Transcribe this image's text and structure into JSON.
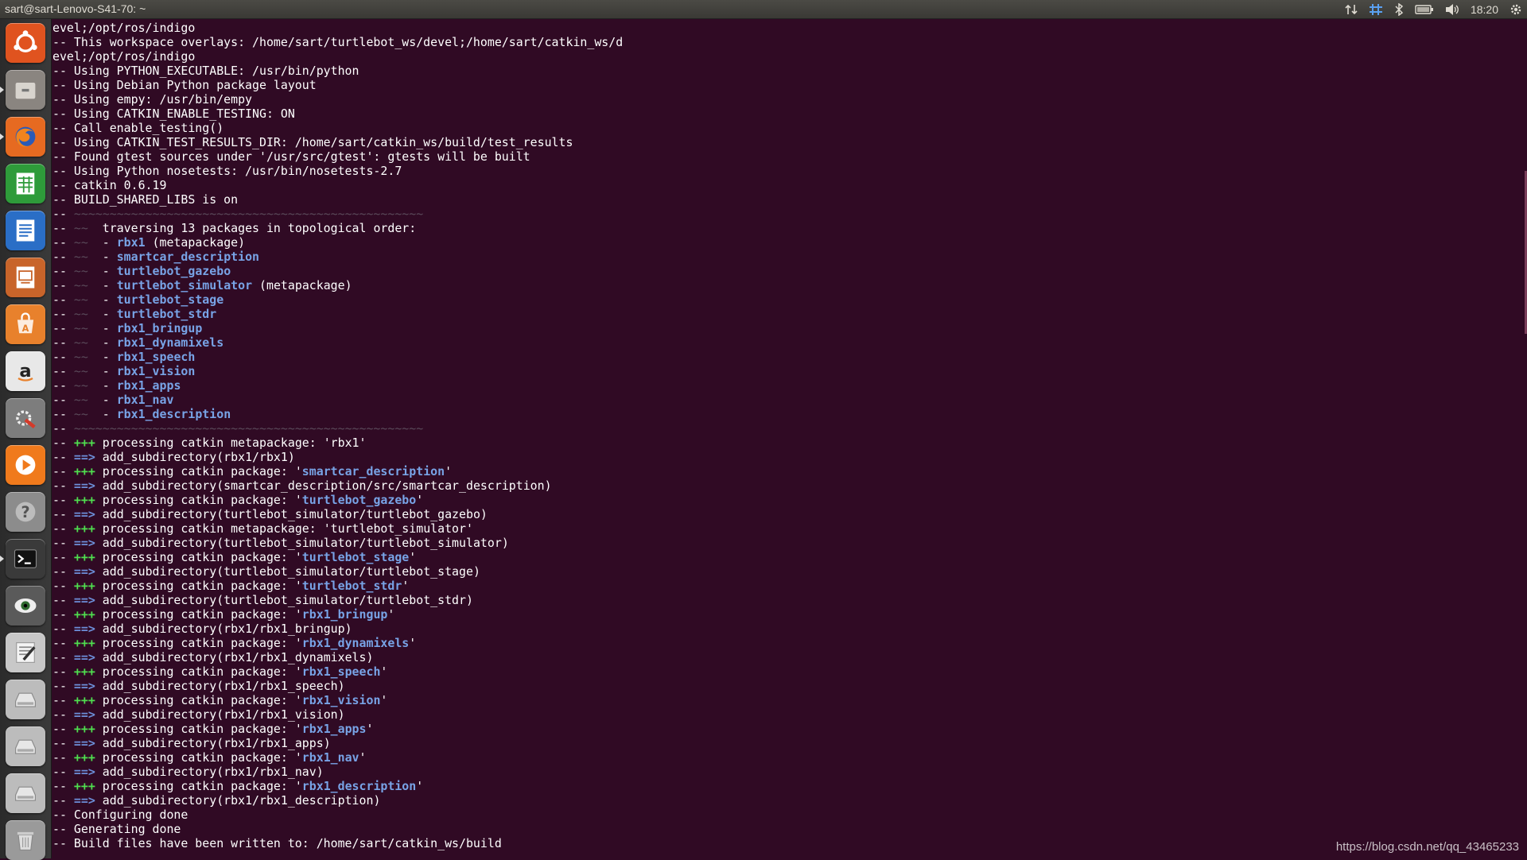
{
  "topbar": {
    "window_title": "sart@sart-Lenovo-S41-70: ~",
    "indicators": [
      {
        "icon": "network-transfer-icon"
      },
      {
        "icon": "input-method-icon"
      },
      {
        "icon": "bluetooth-icon"
      },
      {
        "icon": "battery-icon"
      },
      {
        "icon": "volume-icon"
      },
      {
        "icon": "clock",
        "text": "18:20"
      },
      {
        "icon": "gear-icon"
      }
    ]
  },
  "launcher": {
    "items": [
      {
        "name": "ubuntu-dash-icon",
        "color": "#e0531f"
      },
      {
        "name": "files-icon",
        "color": "#8a8580"
      },
      {
        "name": "firefox-icon",
        "color": "#e66a21"
      },
      {
        "name": "libreoffice-calc-icon",
        "color": "#2e9b3a"
      },
      {
        "name": "libreoffice-writer-icon",
        "color": "#2a6ec6"
      },
      {
        "name": "libreoffice-impress-icon",
        "color": "#c8642a"
      },
      {
        "name": "software-center-icon",
        "color": "#e8812c"
      },
      {
        "name": "amazon-icon",
        "color": "#e8e8e8"
      },
      {
        "name": "system-settings-icon",
        "color": "#7d7d7d"
      },
      {
        "name": "media-player-icon",
        "color": "#f07a1c"
      },
      {
        "name": "help-icon",
        "color": "#8c8c8c"
      },
      {
        "name": "terminal-icon",
        "color": "#3a3a3a"
      },
      {
        "name": "image-viewer-icon",
        "color": "#5a5a5a"
      },
      {
        "name": "text-editor-icon",
        "color": "#c8c8c8"
      },
      {
        "name": "drive-icon-1",
        "color": "#bcbcbc"
      },
      {
        "name": "drive-icon-2",
        "color": "#bcbcbc"
      },
      {
        "name": "drive-icon-3",
        "color": "#bcbcbc"
      },
      {
        "name": "trash-icon",
        "color": "#9a9a9a"
      }
    ]
  },
  "terminal": {
    "lines": [
      [
        {
          "t": "evel;/opt/ros/indigo"
        }
      ],
      [
        {
          "t": "-- This workspace overlays: /home/sart/turtlebot_ws/devel;/home/sart/catkin_ws/d"
        }
      ],
      [
        {
          "t": "evel;/opt/ros/indigo"
        }
      ],
      [
        {
          "t": "-- Using PYTHON_EXECUTABLE: /usr/bin/python"
        }
      ],
      [
        {
          "t": "-- Using Debian Python package layout"
        }
      ],
      [
        {
          "t": "-- Using empy: /usr/bin/empy"
        }
      ],
      [
        {
          "t": "-- Using CATKIN_ENABLE_TESTING: ON"
        }
      ],
      [
        {
          "t": "-- Call enable_testing()"
        }
      ],
      [
        {
          "t": "-- Using CATKIN_TEST_RESULTS_DIR: /home/sart/catkin_ws/build/test_results"
        }
      ],
      [
        {
          "t": "-- Found gtest sources under '/usr/src/gtest': gtests will be built"
        }
      ],
      [
        {
          "t": "-- Using Python nosetests: /usr/bin/nosetests-2.7"
        }
      ],
      [
        {
          "t": "-- catkin 0.6.19"
        }
      ],
      [
        {
          "t": "-- BUILD_SHARED_LIBS is on"
        }
      ],
      [
        {
          "t": "-- "
        },
        {
          "t": "~~~~~~~~~~~~~~~~~~~~~~~~~~~~~~~~~~~~~~~~~~~~~~~~~",
          "c": "dim"
        }
      ],
      [
        {
          "t": "-- "
        },
        {
          "t": "~~",
          "c": "dim"
        },
        {
          "t": "  traversing 13 packages in topological order:"
        }
      ],
      [
        {
          "t": "-- "
        },
        {
          "t": "~~",
          "c": "dim"
        },
        {
          "t": "  - "
        },
        {
          "t": "rbx1",
          "c": "pkg"
        },
        {
          "t": " (metapackage)"
        }
      ],
      [
        {
          "t": "-- "
        },
        {
          "t": "~~",
          "c": "dim"
        },
        {
          "t": "  - "
        },
        {
          "t": "smartcar_description",
          "c": "pkg"
        }
      ],
      [
        {
          "t": "-- "
        },
        {
          "t": "~~",
          "c": "dim"
        },
        {
          "t": "  - "
        },
        {
          "t": "turtlebot_gazebo",
          "c": "pkg"
        }
      ],
      [
        {
          "t": "-- "
        },
        {
          "t": "~~",
          "c": "dim"
        },
        {
          "t": "  - "
        },
        {
          "t": "turtlebot_simulator",
          "c": "pkg"
        },
        {
          "t": " (metapackage)"
        }
      ],
      [
        {
          "t": "-- "
        },
        {
          "t": "~~",
          "c": "dim"
        },
        {
          "t": "  - "
        },
        {
          "t": "turtlebot_stage",
          "c": "pkg"
        }
      ],
      [
        {
          "t": "-- "
        },
        {
          "t": "~~",
          "c": "dim"
        },
        {
          "t": "  - "
        },
        {
          "t": "turtlebot_stdr",
          "c": "pkg"
        }
      ],
      [
        {
          "t": "-- "
        },
        {
          "t": "~~",
          "c": "dim"
        },
        {
          "t": "  - "
        },
        {
          "t": "rbx1_bringup",
          "c": "pkg"
        }
      ],
      [
        {
          "t": "-- "
        },
        {
          "t": "~~",
          "c": "dim"
        },
        {
          "t": "  - "
        },
        {
          "t": "rbx1_dynamixels",
          "c": "pkg"
        }
      ],
      [
        {
          "t": "-- "
        },
        {
          "t": "~~",
          "c": "dim"
        },
        {
          "t": "  - "
        },
        {
          "t": "rbx1_speech",
          "c": "pkg"
        }
      ],
      [
        {
          "t": "-- "
        },
        {
          "t": "~~",
          "c": "dim"
        },
        {
          "t": "  - "
        },
        {
          "t": "rbx1_vision",
          "c": "pkg"
        }
      ],
      [
        {
          "t": "-- "
        },
        {
          "t": "~~",
          "c": "dim"
        },
        {
          "t": "  - "
        },
        {
          "t": "rbx1_apps",
          "c": "pkg"
        }
      ],
      [
        {
          "t": "-- "
        },
        {
          "t": "~~",
          "c": "dim"
        },
        {
          "t": "  - "
        },
        {
          "t": "rbx1_nav",
          "c": "pkg"
        }
      ],
      [
        {
          "t": "-- "
        },
        {
          "t": "~~",
          "c": "dim"
        },
        {
          "t": "  - "
        },
        {
          "t": "rbx1_description",
          "c": "pkg"
        }
      ],
      [
        {
          "t": "-- "
        },
        {
          "t": "~~~~~~~~~~~~~~~~~~~~~~~~~~~~~~~~~~~~~~~~~~~~~~~~~",
          "c": "dim"
        }
      ],
      [
        {
          "t": "-- "
        },
        {
          "t": "+++",
          "c": "plus"
        },
        {
          "t": " processing catkin metapackage: 'rbx1'"
        }
      ],
      [
        {
          "t": "-- "
        },
        {
          "t": "==>",
          "c": "arrow"
        },
        {
          "t": " add_subdirectory(rbx1/rbx1)"
        }
      ],
      [
        {
          "t": "-- "
        },
        {
          "t": "+++",
          "c": "plus"
        },
        {
          "t": " processing catkin package: '"
        },
        {
          "t": "smartcar_description",
          "c": "pkg"
        },
        {
          "t": "'"
        }
      ],
      [
        {
          "t": "-- "
        },
        {
          "t": "==>",
          "c": "arrow"
        },
        {
          "t": " add_subdirectory(smartcar_description/src/smartcar_description)"
        }
      ],
      [
        {
          "t": "-- "
        },
        {
          "t": "+++",
          "c": "plus"
        },
        {
          "t": " processing catkin package: '"
        },
        {
          "t": "turtlebot_gazebo",
          "c": "pkg"
        },
        {
          "t": "'"
        }
      ],
      [
        {
          "t": "-- "
        },
        {
          "t": "==>",
          "c": "arrow"
        },
        {
          "t": " add_subdirectory(turtlebot_simulator/turtlebot_gazebo)"
        }
      ],
      [
        {
          "t": "-- "
        },
        {
          "t": "+++",
          "c": "plus"
        },
        {
          "t": " processing catkin metapackage: 'turtlebot_simulator'"
        }
      ],
      [
        {
          "t": "-- "
        },
        {
          "t": "==>",
          "c": "arrow"
        },
        {
          "t": " add_subdirectory(turtlebot_simulator/turtlebot_simulator)"
        }
      ],
      [
        {
          "t": "-- "
        },
        {
          "t": "+++",
          "c": "plus"
        },
        {
          "t": " processing catkin package: '"
        },
        {
          "t": "turtlebot_stage",
          "c": "pkg"
        },
        {
          "t": "'"
        }
      ],
      [
        {
          "t": "-- "
        },
        {
          "t": "==>",
          "c": "arrow"
        },
        {
          "t": " add_subdirectory(turtlebot_simulator/turtlebot_stage)"
        }
      ],
      [
        {
          "t": "-- "
        },
        {
          "t": "+++",
          "c": "plus"
        },
        {
          "t": " processing catkin package: '"
        },
        {
          "t": "turtlebot_stdr",
          "c": "pkg"
        },
        {
          "t": "'"
        }
      ],
      [
        {
          "t": "-- "
        },
        {
          "t": "==>",
          "c": "arrow"
        },
        {
          "t": " add_subdirectory(turtlebot_simulator/turtlebot_stdr)"
        }
      ],
      [
        {
          "t": "-- "
        },
        {
          "t": "+++",
          "c": "plus"
        },
        {
          "t": " processing catkin package: '"
        },
        {
          "t": "rbx1_bringup",
          "c": "pkg"
        },
        {
          "t": "'"
        }
      ],
      [
        {
          "t": "-- "
        },
        {
          "t": "==>",
          "c": "arrow"
        },
        {
          "t": " add_subdirectory(rbx1/rbx1_bringup)"
        }
      ],
      [
        {
          "t": "-- "
        },
        {
          "t": "+++",
          "c": "plus"
        },
        {
          "t": " processing catkin package: '"
        },
        {
          "t": "rbx1_dynamixels",
          "c": "pkg"
        },
        {
          "t": "'"
        }
      ],
      [
        {
          "t": "-- "
        },
        {
          "t": "==>",
          "c": "arrow"
        },
        {
          "t": " add_subdirectory(rbx1/rbx1_dynamixels)"
        }
      ],
      [
        {
          "t": "-- "
        },
        {
          "t": "+++",
          "c": "plus"
        },
        {
          "t": " processing catkin package: '"
        },
        {
          "t": "rbx1_speech",
          "c": "pkg"
        },
        {
          "t": "'"
        }
      ],
      [
        {
          "t": "-- "
        },
        {
          "t": "==>",
          "c": "arrow"
        },
        {
          "t": " add_subdirectory(rbx1/rbx1_speech)"
        }
      ],
      [
        {
          "t": "-- "
        },
        {
          "t": "+++",
          "c": "plus"
        },
        {
          "t": " processing catkin package: '"
        },
        {
          "t": "rbx1_vision",
          "c": "pkg"
        },
        {
          "t": "'"
        }
      ],
      [
        {
          "t": "-- "
        },
        {
          "t": "==>",
          "c": "arrow"
        },
        {
          "t": " add_subdirectory(rbx1/rbx1_vision)"
        }
      ],
      [
        {
          "t": "-- "
        },
        {
          "t": "+++",
          "c": "plus"
        },
        {
          "t": " processing catkin package: '"
        },
        {
          "t": "rbx1_apps",
          "c": "pkg"
        },
        {
          "t": "'"
        }
      ],
      [
        {
          "t": "-- "
        },
        {
          "t": "==>",
          "c": "arrow"
        },
        {
          "t": " add_subdirectory(rbx1/rbx1_apps)"
        }
      ],
      [
        {
          "t": "-- "
        },
        {
          "t": "+++",
          "c": "plus"
        },
        {
          "t": " processing catkin package: '"
        },
        {
          "t": "rbx1_nav",
          "c": "pkg"
        },
        {
          "t": "'"
        }
      ],
      [
        {
          "t": "-- "
        },
        {
          "t": "==>",
          "c": "arrow"
        },
        {
          "t": " add_subdirectory(rbx1/rbx1_nav)"
        }
      ],
      [
        {
          "t": "-- "
        },
        {
          "t": "+++",
          "c": "plus"
        },
        {
          "t": " processing catkin package: '"
        },
        {
          "t": "rbx1_description",
          "c": "pkg"
        },
        {
          "t": "'"
        }
      ],
      [
        {
          "t": "-- "
        },
        {
          "t": "==>",
          "c": "arrow"
        },
        {
          "t": " add_subdirectory(rbx1/rbx1_description)"
        }
      ],
      [
        {
          "t": "-- Configuring done"
        }
      ],
      [
        {
          "t": "-- Generating done"
        }
      ],
      [
        {
          "t": "-- Build files have been written to: /home/sart/catkin_ws/build"
        }
      ]
    ]
  },
  "watermark": "https://blog.csdn.net/qq_43465233"
}
